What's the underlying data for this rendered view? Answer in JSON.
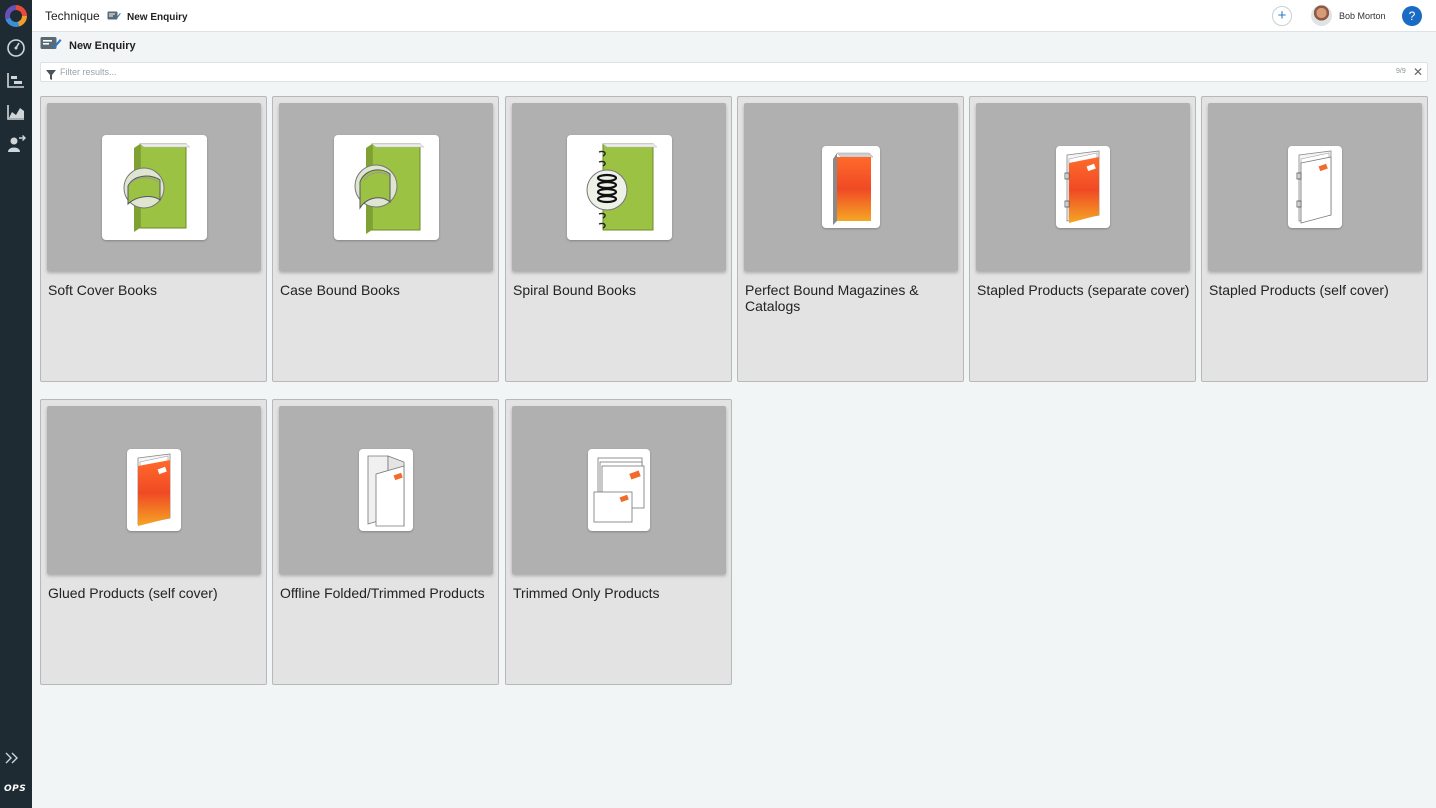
{
  "topbar": {
    "app_name": "Technique",
    "breadcrumb_label": "New Enquiry",
    "user_name": "Bob Morton",
    "add_label": "+",
    "help_label": "?"
  },
  "sidebar": {
    "items": [
      {
        "icon": "dashboard-icon"
      },
      {
        "icon": "schedule-icon"
      },
      {
        "icon": "reports-chart-icon"
      },
      {
        "icon": "user-transfer-icon"
      }
    ],
    "expand_icon": "chevron-double-right-icon",
    "brand": "OPS"
  },
  "page": {
    "title": "New Enquiry"
  },
  "filter": {
    "placeholder": "Filter results...",
    "count": "9/9",
    "clear_label": "✕"
  },
  "products": [
    {
      "label": "Soft Cover Books",
      "icon": "soft-cover-book-icon"
    },
    {
      "label": "Case Bound Books",
      "icon": "case-bound-book-icon"
    },
    {
      "label": "Spiral Bound Books",
      "icon": "spiral-bound-book-icon"
    },
    {
      "label": "Perfect Bound Magazines & Catalogs",
      "icon": "perfect-bound-magazine-icon"
    },
    {
      "label": "Stapled Products (separate cover)",
      "icon": "stapled-separate-cover-icon"
    },
    {
      "label": "Stapled Products (self cover)",
      "icon": "stapled-self-cover-icon"
    },
    {
      "label": "Glued Products (self cover)",
      "icon": "glued-self-cover-icon"
    },
    {
      "label": "Offline Folded/Trimmed Products",
      "icon": "folded-trimmed-icon"
    },
    {
      "label": "Trimmed Only Products",
      "icon": "trimmed-only-icon"
    }
  ],
  "colors": {
    "sidebar": "#1e2b33",
    "accent": "#1a6bc4",
    "book_green": "#9bc243",
    "magazine_orange": "#f26b2b"
  }
}
